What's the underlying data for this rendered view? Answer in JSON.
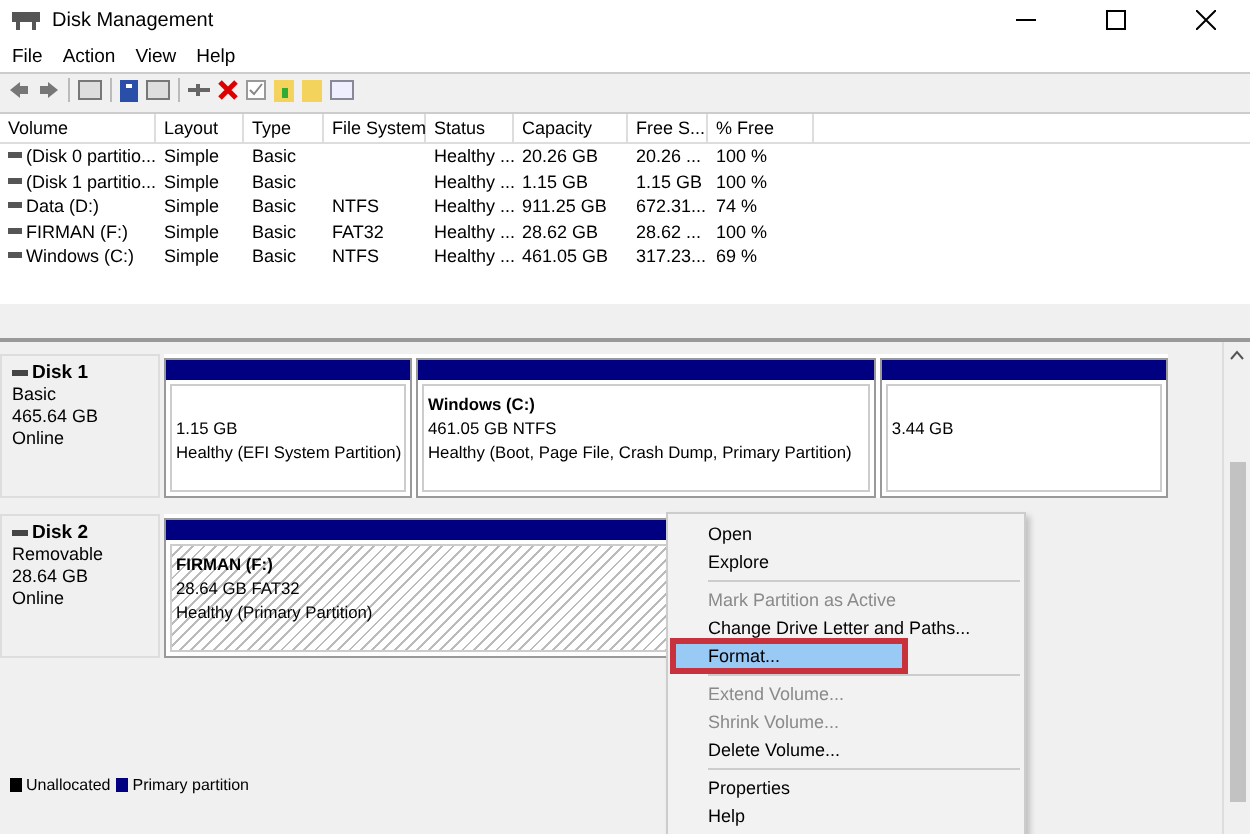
{
  "window": {
    "title": "Disk Management"
  },
  "menu_bar": [
    "File",
    "Action",
    "View",
    "Help"
  ],
  "volume_table": {
    "columns": [
      "Volume",
      "Layout",
      "Type",
      "File System",
      "Status",
      "Capacity",
      "Free S...",
      "% Free"
    ],
    "rows": [
      [
        "(Disk 0 partitio...",
        "Simple",
        "Basic",
        "",
        "Healthy ...",
        "20.26 GB",
        "20.26 ...",
        "100 %"
      ],
      [
        "(Disk 1 partitio...",
        "Simple",
        "Basic",
        "",
        "Healthy ...",
        "1.15 GB",
        "1.15 GB",
        "100 %"
      ],
      [
        "Data (D:)",
        "Simple",
        "Basic",
        "NTFS",
        "Healthy ...",
        "911.25 GB",
        "672.31...",
        "74 %"
      ],
      [
        "FIRMAN (F:)",
        "Simple",
        "Basic",
        "FAT32",
        "Healthy ...",
        "28.62 GB",
        "28.62 ...",
        "100 %"
      ],
      [
        "Windows (C:)",
        "Simple",
        "Basic",
        "NTFS",
        "Healthy ...",
        "461.05 GB",
        "317.23...",
        "69 %"
      ]
    ]
  },
  "disks": [
    {
      "name": "Disk 1",
      "type": "Basic",
      "size": "465.64 GB",
      "status": "Online",
      "partitions": [
        {
          "size": "1.15 GB",
          "status": "Healthy (EFI System Partition)",
          "selected": false
        },
        {
          "name": "Windows  (C:)",
          "size": "461.05 GB NTFS",
          "status": "Healthy (Boot, Page File, Crash Dump, Primary Partition)",
          "selected": false
        },
        {
          "size": "3.44 GB",
          "selected": false
        }
      ]
    },
    {
      "name": "Disk 2",
      "type": "Removable",
      "size": "28.64 GB",
      "status": "Online",
      "partitions": [
        {
          "name": "FIRMAN  (F:)",
          "size": "28.64 GB FAT32",
          "status": "Healthy (Primary Partition)",
          "selected": true
        }
      ]
    }
  ],
  "legend": [
    {
      "label": "Unallocated",
      "color": "#000000"
    },
    {
      "label": "Primary partition",
      "color": "#000080"
    }
  ],
  "context_menu": [
    {
      "label": "Open",
      "disabled": false,
      "selected": false,
      "separator_before": false,
      "outlined": false
    },
    {
      "label": "Explore",
      "disabled": false,
      "selected": false,
      "separator_before": false,
      "outlined": false
    },
    {
      "label": "Mark Partition as Active",
      "disabled": true,
      "selected": false,
      "separator_before": true,
      "outlined": false
    },
    {
      "label": "Change Drive Letter and Paths...",
      "disabled": false,
      "selected": false,
      "separator_before": false,
      "outlined": false
    },
    {
      "label": "Format...",
      "disabled": false,
      "selected": true,
      "separator_before": false,
      "outlined": true
    },
    {
      "label": "Extend Volume...",
      "disabled": true,
      "selected": false,
      "separator_before": true,
      "outlined": false
    },
    {
      "label": "Shrink Volume...",
      "disabled": true,
      "selected": false,
      "separator_before": false,
      "outlined": false
    },
    {
      "label": "Delete Volume...",
      "disabled": false,
      "selected": false,
      "separator_before": false,
      "outlined": false
    },
    {
      "label": "Properties",
      "disabled": false,
      "selected": false,
      "separator_before": true,
      "outlined": false
    },
    {
      "label": "Help",
      "disabled": false,
      "selected": false,
      "separator_before": false,
      "outlined": false
    }
  ]
}
